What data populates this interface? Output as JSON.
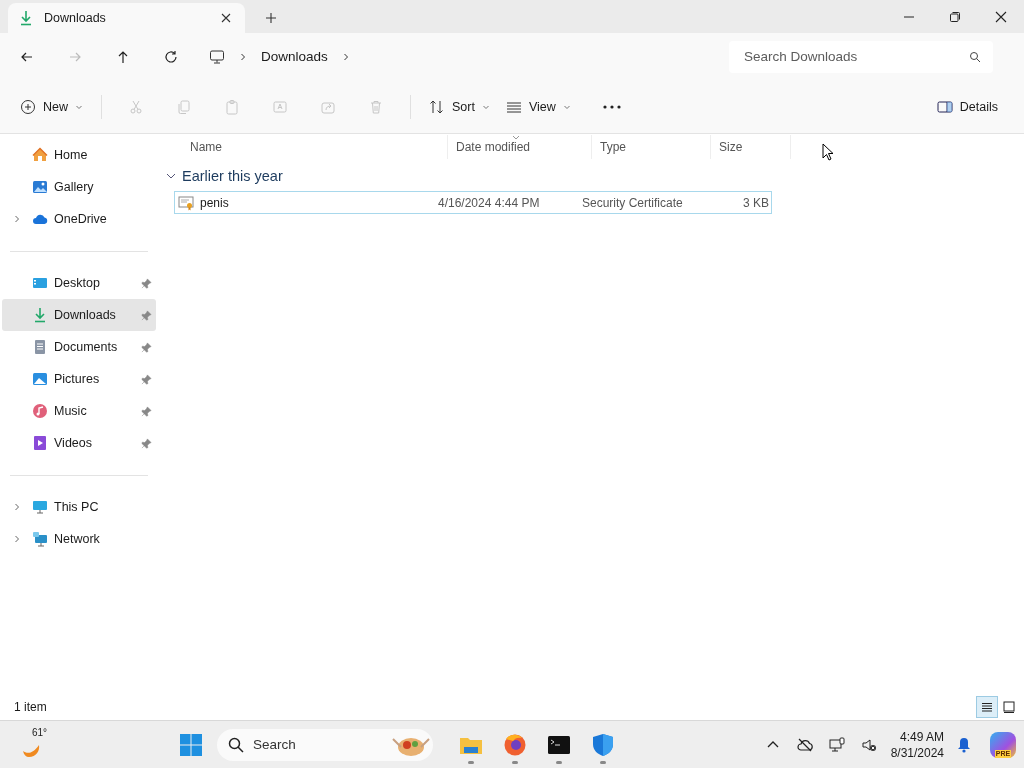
{
  "tab": {
    "title": "Downloads",
    "selected": true
  },
  "nav": [
    {
      "disabled": false
    },
    {
      "disabled": true
    },
    {
      "disabled": false
    },
    {
      "disabled": false
    }
  ],
  "breadcrumb": [
    {
      "label": "Downloads"
    }
  ],
  "search": {
    "placeholder": "Search Downloads"
  },
  "toolbar": {
    "new": {
      "label": "New"
    },
    "edit_actions": [
      {
        "disabled": true
      },
      {
        "disabled": true
      },
      {
        "disabled": true
      },
      {
        "disabled": true
      },
      {
        "disabled": true
      },
      {
        "disabled": true
      }
    ],
    "sort": {
      "label": "Sort"
    },
    "view": {
      "label": "View"
    },
    "details": {
      "label": "Details"
    }
  },
  "sidebar": {
    "sections": [
      {
        "items": [
          {
            "label": "Home",
            "expandable": false,
            "pinned": false,
            "selected": false
          },
          {
            "label": "Gallery",
            "expandable": false,
            "pinned": false,
            "selected": false
          },
          {
            "label": "OneDrive",
            "expandable": true,
            "pinned": false,
            "selected": false
          }
        ]
      },
      {
        "items": [
          {
            "label": "Desktop",
            "expandable": false,
            "pinned": true,
            "selected": false
          },
          {
            "label": "Downloads",
            "expandable": false,
            "pinned": true,
            "selected": true
          },
          {
            "label": "Documents",
            "expandable": false,
            "pinned": true,
            "selected": false
          },
          {
            "label": "Pictures",
            "expandable": false,
            "pinned": true,
            "selected": false
          },
          {
            "label": "Music",
            "expandable": false,
            "pinned": true,
            "selected": false
          },
          {
            "label": "Videos",
            "expandable": false,
            "pinned": true,
            "selected": false
          }
        ]
      },
      {
        "items": [
          {
            "label": "This PC",
            "expandable": true,
            "pinned": false,
            "selected": false
          },
          {
            "label": "Network",
            "expandable": true,
            "pinned": false,
            "selected": false
          }
        ]
      }
    ]
  },
  "columns": [
    {
      "label": "Name",
      "sorted": false
    },
    {
      "label": "Date modified",
      "sorted": true
    },
    {
      "label": "Type",
      "sorted": false
    },
    {
      "label": "Size",
      "sorted": false
    }
  ],
  "groups": [
    {
      "label": "Earlier this year",
      "expanded": true,
      "files": [
        {
          "name": "penis",
          "date": "4/16/2024 4:44 PM",
          "type": "Security Certificate",
          "size": "3 KB",
          "focused": true
        }
      ]
    }
  ],
  "status_bar": {
    "count": "1 item",
    "views": [
      {
        "selected": true
      },
      {
        "selected": false
      }
    ]
  },
  "taskbar": {
    "weather": "61°",
    "search": {
      "placeholder": "Search"
    },
    "apps": [
      {
        "running": true
      },
      {
        "running": true
      },
      {
        "running": true
      },
      {
        "running": true
      }
    ],
    "time": "4:49 AM",
    "date": "8/31/2024",
    "copilot_badge": "PRE"
  }
}
